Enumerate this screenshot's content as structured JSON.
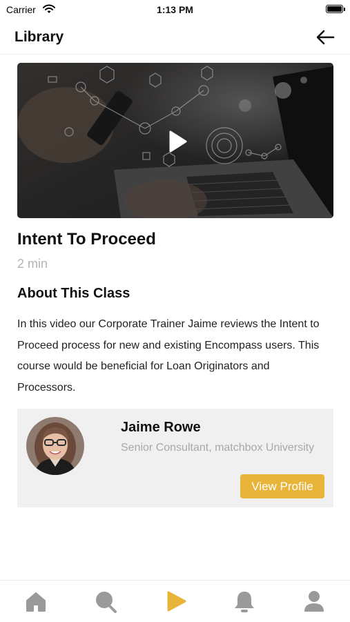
{
  "status_bar": {
    "carrier": "Carrier",
    "time": "1:13 PM"
  },
  "header": {
    "title": "Library",
    "back_icon": "arrow-left-icon"
  },
  "video": {
    "play_icon": "play-icon"
  },
  "class": {
    "title": "Intent To Proceed",
    "duration": "2 min",
    "about_heading": "About This Class",
    "about_text": "In this video our Corporate Trainer Jaime reviews the Intent to Proceed process for new and existing Encompass users. This course would be beneficial for Loan Originators and Processors."
  },
  "instructor": {
    "name": "Jaime Rowe",
    "role": "Senior Consultant, matchbox University",
    "button_label": "View Profile"
  },
  "tab_bar": {
    "items": [
      {
        "icon": "home-icon",
        "active": false
      },
      {
        "icon": "search-icon",
        "active": false
      },
      {
        "icon": "play-icon",
        "active": true
      },
      {
        "icon": "bell-icon",
        "active": false
      },
      {
        "icon": "user-icon",
        "active": false
      }
    ]
  },
  "colors": {
    "accent": "#E8B53A",
    "tab_inactive": "#9A9A9A",
    "muted_text": "#A8A8A8",
    "card_background": "#F0F0F0"
  }
}
